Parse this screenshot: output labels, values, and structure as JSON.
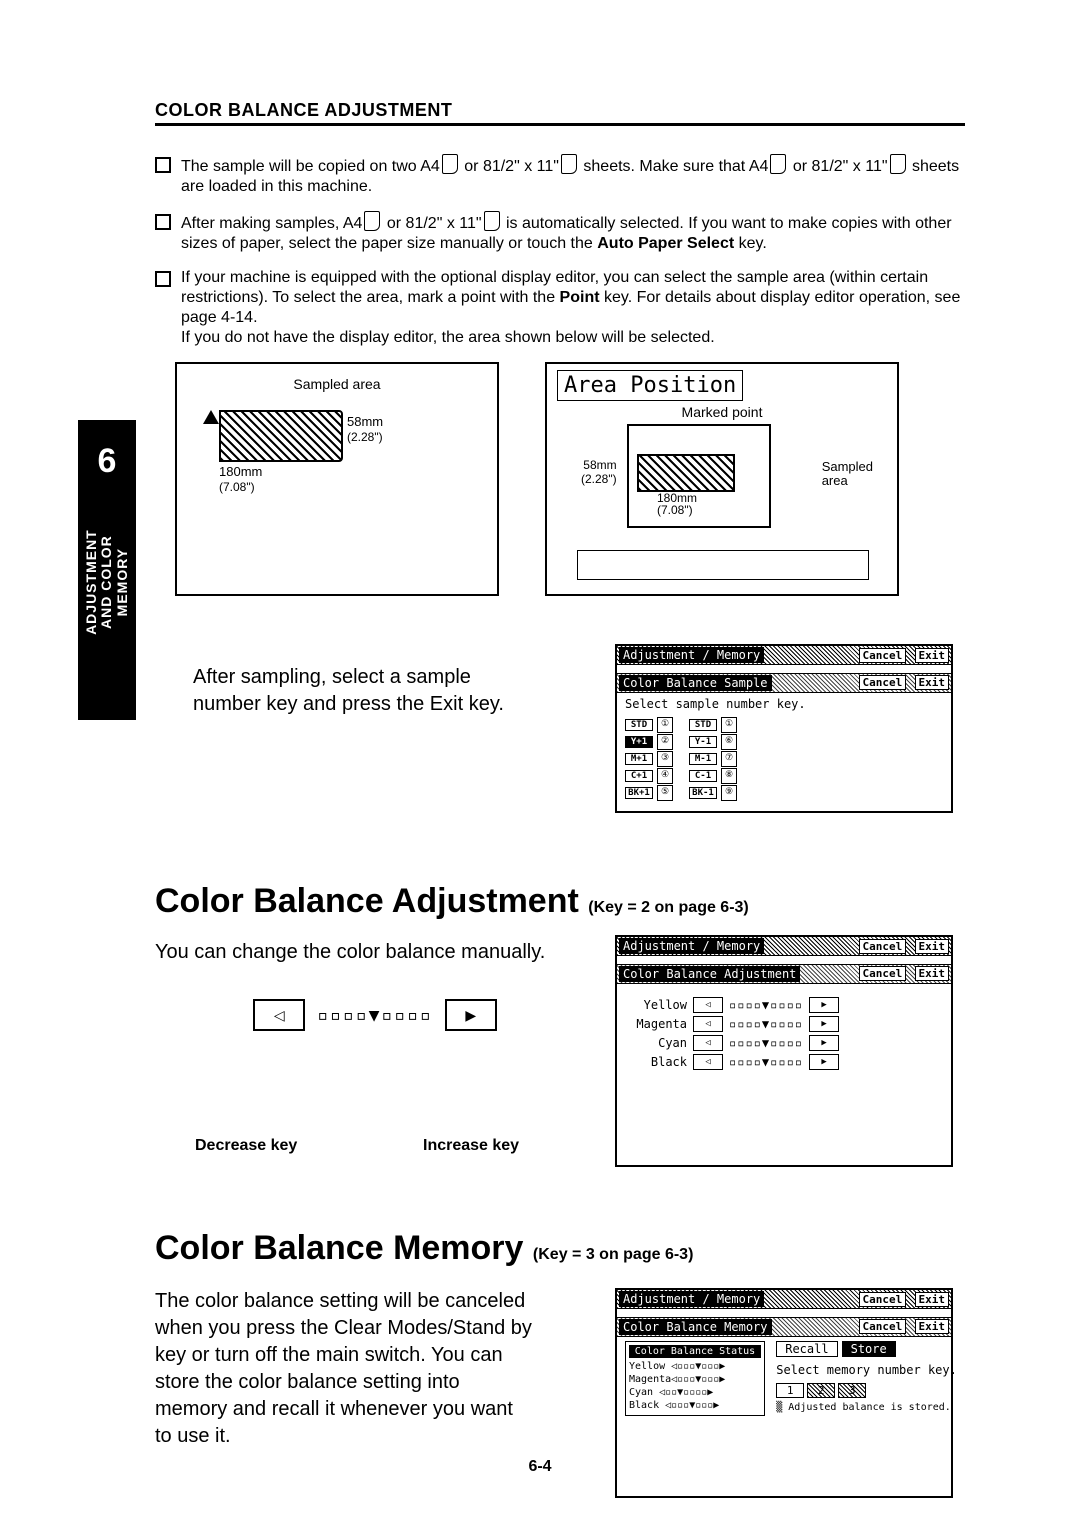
{
  "header": "COLOR BALANCE ADJUSTMENT",
  "bullets": {
    "b1a": "The sample will be copied on two A4",
    "b1b": "or 81/2\" x 11\"",
    "b1c": "sheets.  Make sure that A4",
    "b1d": "or 81/2\" x 11\"",
    "b1e": "sheets are loaded in this machine.",
    "b2a": "After making samples, A4",
    "b2b": "or 81/2\" x 11\"",
    "b2c": "is automatically selected. If you want to make copies with other sizes of paper, select the paper size manually or touch the ",
    "b2d": "Auto Paper Select",
    "b2e": " key.",
    "b3a": "If your machine is equipped with the optional display editor, you can select the sample area (within certain restrictions). To select the area, mark a point with the ",
    "b3b": "Point",
    "b3c": " key.  For details about display editor operation, see page 4-14.",
    "b3d": "If you do not have the display editor, the area shown below will be selected."
  },
  "side": {
    "num": "6",
    "line1": "ADJUSTMENT",
    "line2": "AND COLOR MEMORY"
  },
  "diag": {
    "leftCaption": "Sampled area",
    "d180": "180mm",
    "d180s": "(7.08\")",
    "d58": "58mm",
    "d58s": "(2.28\")",
    "rightTitle": "Area Position",
    "marked": "Marked point",
    "sampled1": "Sampled",
    "sampled2": "area"
  },
  "after": {
    "text": "After sampling, select a sample number key and press the Exit key."
  },
  "panel1": {
    "title": "Adjustment / Memory",
    "cancel": "Cancel",
    "exit": "Exit",
    "subtitle": "Color Balance Sample",
    "msg": "Select sample number key.",
    "col1": [
      "STD",
      "Y+1",
      "M+1",
      "C+1",
      "BK+1"
    ],
    "num1": [
      "①",
      "②",
      "③",
      "④",
      "⑤"
    ],
    "col2": [
      "STD",
      "Y-1",
      "M-1",
      "C-1",
      "BK-1"
    ],
    "num2": [
      "①",
      "⑥",
      "⑦",
      "⑧",
      "⑨"
    ]
  },
  "h2a": "Color Balance Adjustment",
  "h2anote": "(Key = 2 on page 6-3)",
  "adj": {
    "text": "You can change the color balance manually.",
    "decIcon": "◁",
    "bar": "▫▫▫▫▼▫▫▫▫",
    "incIcon": "▶",
    "dec": "Decrease key",
    "inc": "Increase key"
  },
  "panel2": {
    "subtitle": "Color Balance Adjustment",
    "colors": [
      "Yellow",
      "Magenta",
      "Cyan",
      "Black"
    ]
  },
  "h2b": "Color Balance Memory",
  "h2bnote": "(Key = 3 on page 6-3)",
  "mem": {
    "text": "The color balance setting will be canceled when you press the Clear Modes/Stand by key or turn off the main switch.  You can store the color balance setting into memory and recall it whenever you want to use it."
  },
  "panel3": {
    "subtitle": "Color Balance Memory",
    "statusTitle": "Color Balance Status",
    "lines": [
      "Yellow ◁▫▫▫▼▫▫▫▶",
      "Magenta◁▫▫▫▼▫▫▫▶",
      "Cyan  ◁▫▫▼▫▫▫▫▶",
      "Black ◁▫▫▫▼▫▫▫▶"
    ],
    "recall": "Recall",
    "store": "Store",
    "hint": "Select memory number key.",
    "slots": [
      "1",
      "2",
      "3"
    ],
    "note": "▒ Adjusted balance is stored."
  },
  "pageNum": "6-4"
}
